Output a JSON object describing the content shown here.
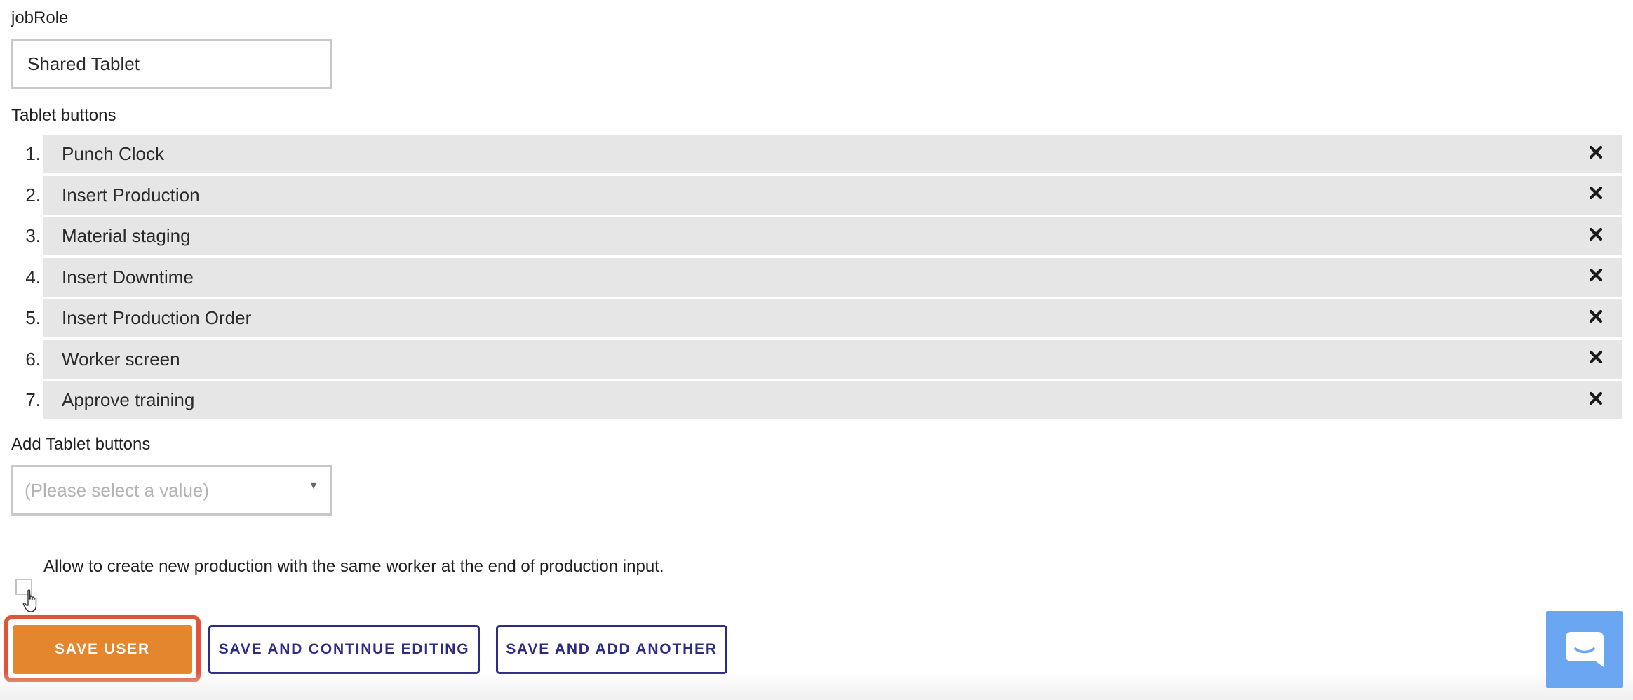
{
  "job_role": {
    "label": "jobRole",
    "value": "Shared Tablet"
  },
  "tablet_buttons": {
    "label": "Tablet buttons",
    "items": [
      {
        "number": "1.",
        "label": "Punch Clock"
      },
      {
        "number": "2.",
        "label": "Insert Production"
      },
      {
        "number": "3.",
        "label": "Material staging"
      },
      {
        "number": "4.",
        "label": "Insert Downtime"
      },
      {
        "number": "5.",
        "label": "Insert Production Order"
      },
      {
        "number": "6.",
        "label": "Worker screen"
      },
      {
        "number": "7.",
        "label": "Approve training"
      }
    ],
    "remove_icon": "close-x-icon"
  },
  "add_tablet_buttons": {
    "label": "Add Tablet buttons",
    "placeholder": "(Please select a value)"
  },
  "same_worker_option": {
    "label": "Allow to create new production with the same worker at the end of production input.",
    "checked": false
  },
  "actions": {
    "save_user": "SAVE USER",
    "save_continue": "SAVE AND CONTINUE EDITING",
    "save_add_another": "SAVE AND ADD ANOTHER"
  },
  "colors": {
    "primary_button": "#e3862e",
    "primary_highlight": "#e0553a",
    "outline_button": "#2d2b85",
    "list_row_bg": "#e6e6e6",
    "chat_button": "#6aa6f2"
  },
  "icons": {
    "chat": "chat-bubble-icon",
    "cursor": "hand-pointer-icon"
  }
}
